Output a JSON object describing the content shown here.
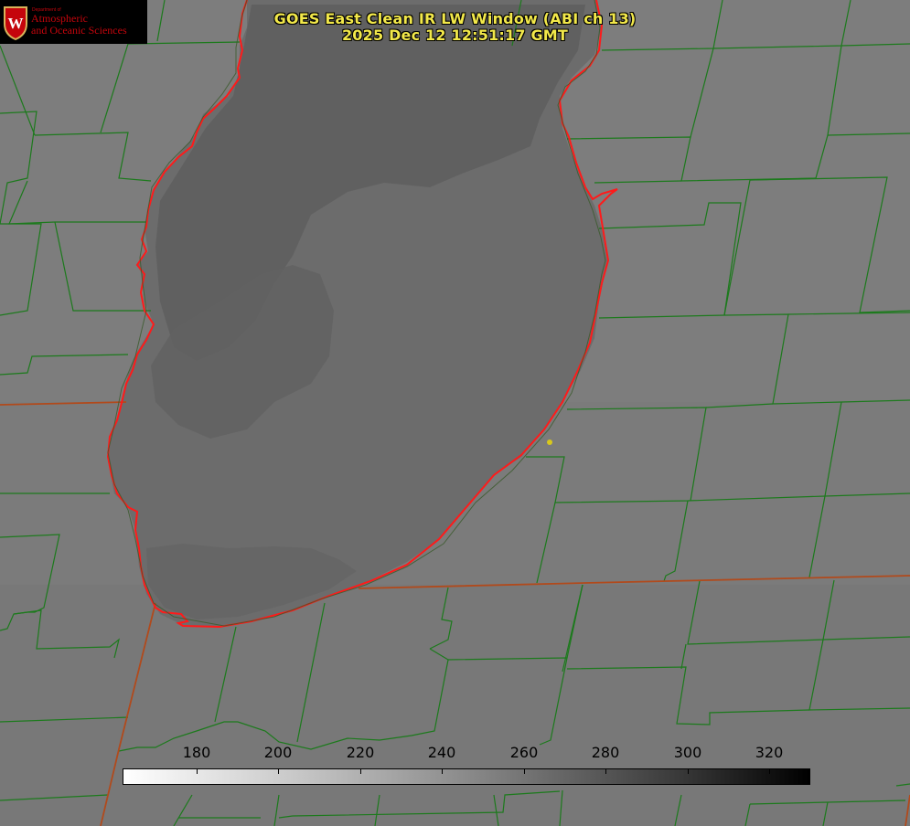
{
  "title": {
    "line1": "GOES East Clean IR LW Window (ABI ch 13)",
    "line2": "2025 Dec 12 12:51:17 GMT"
  },
  "logo": {
    "department": "Department of",
    "name_line1": "Atmospheric",
    "name_line2": "and Oceanic Sciences",
    "crest_letter": "W"
  },
  "colorbar": {
    "ticks": [
      "180",
      "200",
      "220",
      "240",
      "260",
      "280",
      "300",
      "320"
    ]
  },
  "colors": {
    "background": "#7c7c7c",
    "lake_fill": "#6e6e6e",
    "cloud_dark": "#5e5e5e",
    "shoreline": "#ff1a1a",
    "county_lines": "#1a7a1a",
    "state_lines": "#b8461a",
    "title_text": "#f2e84a",
    "marker": "#d8c81c"
  }
}
